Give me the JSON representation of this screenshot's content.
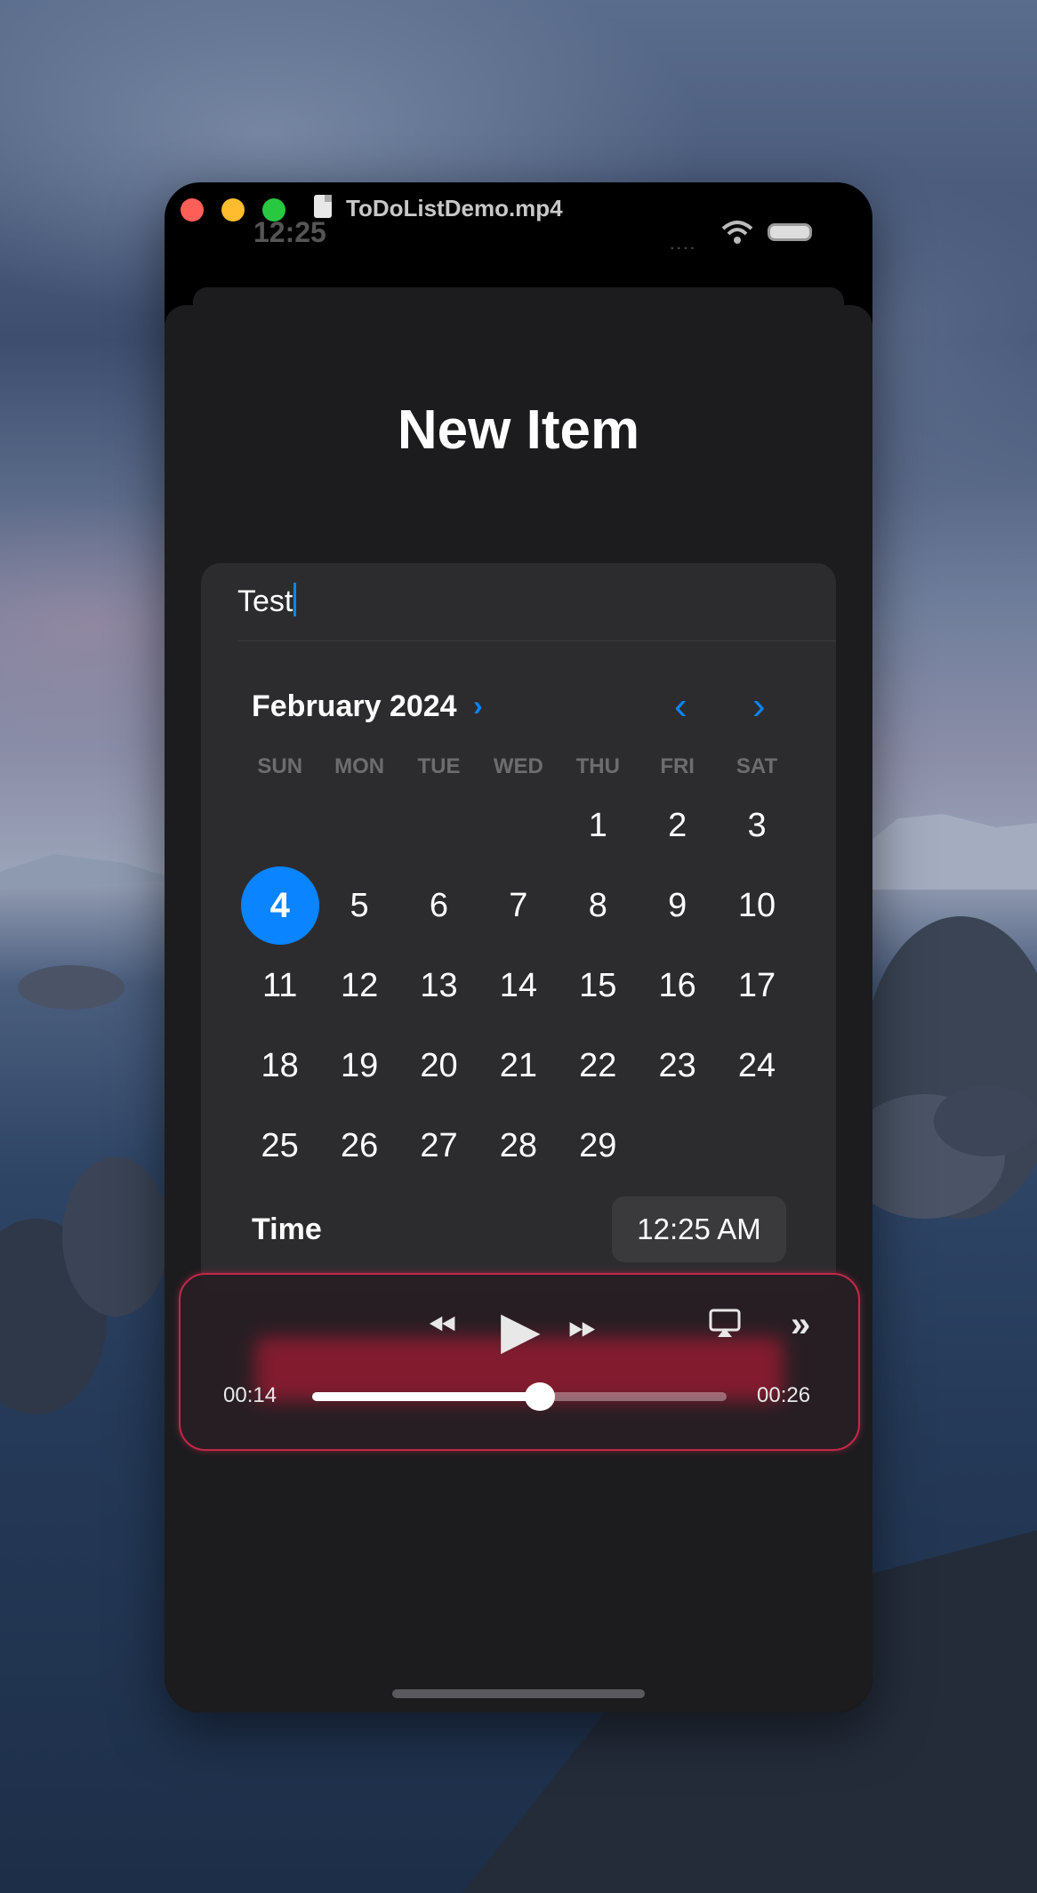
{
  "window": {
    "title": "ToDoListDemo.mp4"
  },
  "status_bar": {
    "time": "12:25",
    "signal": "...."
  },
  "sheet": {
    "title": "New Item"
  },
  "form": {
    "title_field_value": "Test",
    "calendar": {
      "month_label": "February 2024",
      "weekdays": [
        "SUN",
        "MON",
        "TUE",
        "WED",
        "THU",
        "FRI",
        "SAT"
      ],
      "leading_blanks": 4,
      "days": [
        "1",
        "2",
        "3",
        "4",
        "5",
        "6",
        "7",
        "8",
        "9",
        "10",
        "11",
        "12",
        "13",
        "14",
        "15",
        "16",
        "17",
        "18",
        "19",
        "20",
        "21",
        "22",
        "23",
        "24",
        "25",
        "26",
        "27",
        "28",
        "29"
      ],
      "selected_day": "4"
    },
    "time_label": "Time",
    "time_value": "12:25 AM"
  },
  "player": {
    "elapsed": "00:14",
    "remaining": "00:26",
    "progress": 0.55
  },
  "colors": {
    "accent": "#0a84ff",
    "sheet": "#1c1c1e",
    "card": "#2c2c2e",
    "player_border": "#c3284a"
  }
}
